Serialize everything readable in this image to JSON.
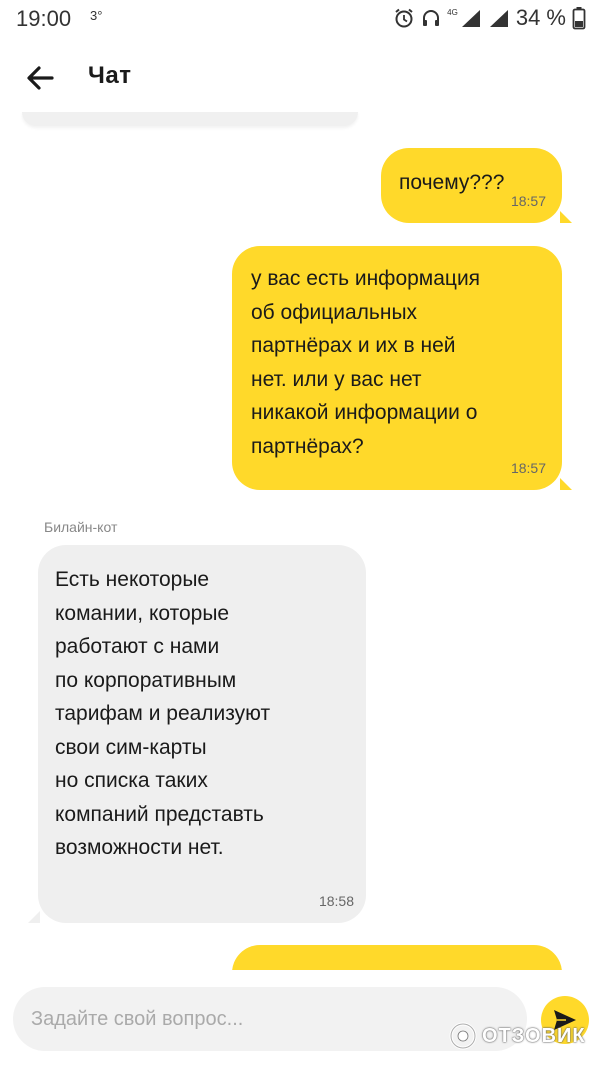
{
  "status_bar": {
    "time": "19:00",
    "temperature": "3°",
    "network": "4G",
    "battery": "34 %"
  },
  "header": {
    "title": "Чат"
  },
  "messages": [
    {
      "direction": "outgoing",
      "text": "почему???",
      "time": "18:57"
    },
    {
      "direction": "outgoing",
      "text": "у вас есть информация\nоб официальных\nпартнёрах и их в ней\nнет. или у вас нет\nникакой информации о\nпартнёрах?",
      "time": "18:57"
    },
    {
      "direction": "incoming",
      "sender": "Билайн-кот",
      "text": "Есть некоторые\nкомании, которые\nработают с нами\nпо корпоративным\nтарифам и реализуют\nсвои сим-карты\nно списка таких\nкомпаний представть\nвозможности нет.",
      "time": "18:58"
    }
  ],
  "input": {
    "placeholder": "Задайте свой вопрос..."
  },
  "watermark": "ОТЗОВИК",
  "colors": {
    "accent": "#ffd92a",
    "incoming_bubble": "#efefef"
  }
}
